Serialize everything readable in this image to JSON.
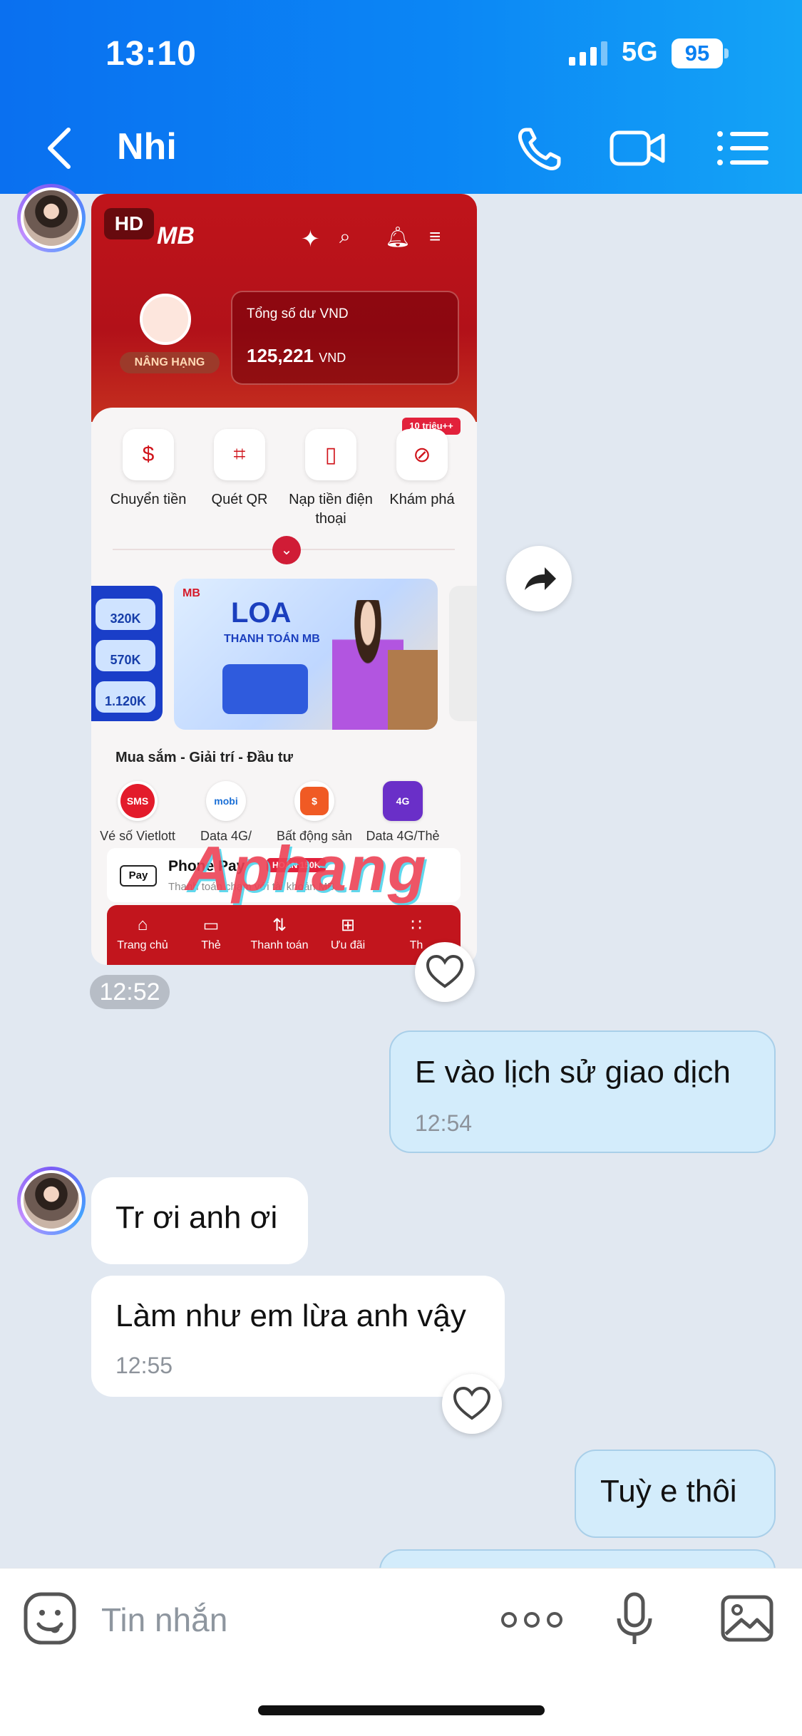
{
  "status_bar": {
    "time": "13:10",
    "network": "5G",
    "battery": "95"
  },
  "header": {
    "title": "Nhi"
  },
  "shared_image": {
    "hd_badge": "HD",
    "bank_logo": "MB",
    "rank_label": "NÂNG HẠNG",
    "balance_label": "Tổng số dư VND",
    "balance_amount": "125,221",
    "balance_currency": "VND",
    "prize_tag": "10 triệu++",
    "quick_actions": [
      {
        "label": "Chuyển tiền"
      },
      {
        "label": "Quét QR"
      },
      {
        "label": "Nạp tiền điện thoại"
      },
      {
        "label": "Khám phá"
      }
    ],
    "promo_left": [
      "320K",
      "570K",
      "1.120K"
    ],
    "promo_main": {
      "brand": "MB",
      "title": "LOA",
      "subtitle": "THANH TOÁN MB"
    },
    "section_title": "Mua sắm -  Giải trí - Đầu tư",
    "services": [
      {
        "label": "Vé số Vietlott",
        "badge": "SMS",
        "color": "#e31b2b"
      },
      {
        "label": "Data 4G/",
        "badge": "mobi",
        "color": "#1a6fd6"
      },
      {
        "label": "Bất động sản",
        "badge": "$",
        "color": "#f05a24"
      },
      {
        "label": "Data 4G/Thẻ",
        "badge": "4G",
        "color": "#6a2fc8"
      }
    ],
    "apple_pay": {
      "logo": "Pay",
      "name": "Phone Pay",
      "tag": "HOÀN 150K",
      "desc": "Thanh toán chạm với tài khoản MB"
    },
    "bottom_nav": [
      {
        "label": "Trang chủ",
        "icon": "⌂"
      },
      {
        "label": "Thẻ",
        "icon": "▭"
      },
      {
        "label": "Thanh toán",
        "icon": "⇅"
      },
      {
        "label": "Ưu đãi",
        "icon": "⊞"
      },
      {
        "label": "Th",
        "icon": "∷"
      }
    ],
    "watermark": "Aphang"
  },
  "messages": {
    "image_time": "12:52",
    "m1": {
      "text": "E vào lịch sử giao dịch",
      "time": "12:54"
    },
    "m2": {
      "text": "Tr ơi anh ơi"
    },
    "m3": {
      "text": "Làm như em lừa anh vậy",
      "time": "12:55"
    },
    "m4": {
      "text": "Tuỳ e thôi"
    }
  },
  "input": {
    "placeholder": "Tin nhắn"
  },
  "colors": {
    "header_blue": "#0b86f5",
    "bank_red": "#c0141b",
    "out_bubble": "#d3ecfb"
  }
}
